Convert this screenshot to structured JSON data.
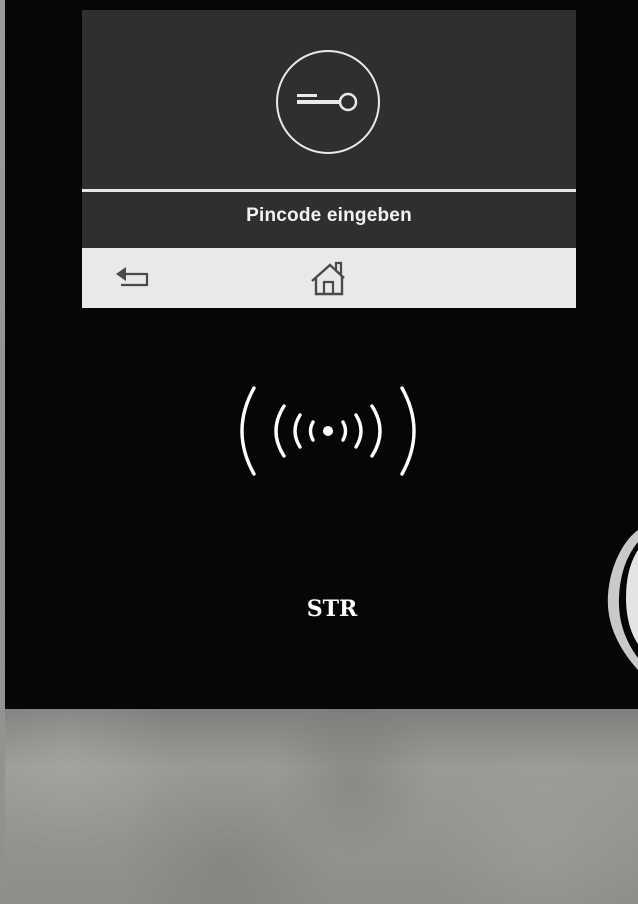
{
  "screen": {
    "icon": "key-icon",
    "label": "Pincode eingeben",
    "nav": [
      {
        "icon": "back-arrow-icon"
      },
      {
        "icon": "home-icon"
      }
    ]
  },
  "reader": {
    "icon": "rfid-wireless-icon"
  },
  "logo": {
    "text": "STR"
  },
  "colors": {
    "panel": "#060606",
    "screen": "#2f2f2f",
    "screen_bar": "#e9e9e9",
    "text": "#f2f2f2"
  }
}
